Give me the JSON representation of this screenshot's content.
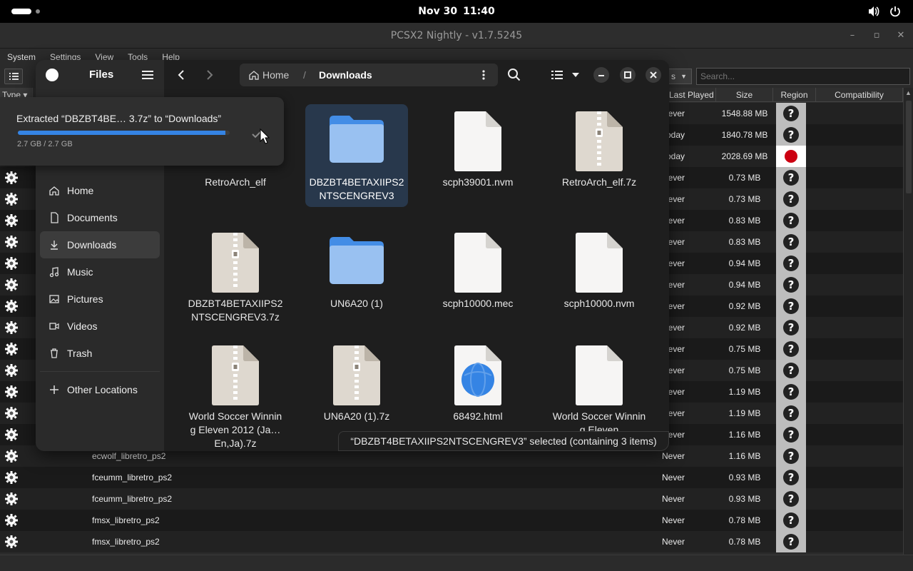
{
  "topbar": {
    "date": "Nov 30",
    "time": "11:40"
  },
  "pcsx2": {
    "title": "PCSX2 Nightly - v1.7.5245",
    "menu": [
      "System",
      "Settings",
      "View",
      "Tools",
      "Help"
    ],
    "view_combo": "s",
    "search_placeholder": "Search...",
    "columns": {
      "type": "Type",
      "last_played": "Last Played",
      "size": "Size",
      "region": "Region",
      "compatibility": "Compatibility"
    },
    "rows": [
      {
        "title": "",
        "last": "Never",
        "size": "1548.88 MB",
        "region": "unknown"
      },
      {
        "title": "",
        "last": "Today",
        "size": "1840.78 MB",
        "region": "unknown"
      },
      {
        "title": "",
        "last": "Today",
        "size": "2028.69 MB",
        "region": "japan"
      },
      {
        "title": "",
        "last": "Never",
        "size": "0.73 MB",
        "region": "unknown"
      },
      {
        "title": "",
        "last": "Never",
        "size": "0.73 MB",
        "region": "unknown"
      },
      {
        "title": "",
        "last": "Never",
        "size": "0.83 MB",
        "region": "unknown"
      },
      {
        "title": "",
        "last": "Never",
        "size": "0.83 MB",
        "region": "unknown"
      },
      {
        "title": "",
        "last": "Never",
        "size": "0.94 MB",
        "region": "unknown"
      },
      {
        "title": "",
        "last": "Never",
        "size": "0.94 MB",
        "region": "unknown"
      },
      {
        "title": "",
        "last": "Never",
        "size": "0.92 MB",
        "region": "unknown"
      },
      {
        "title": "",
        "last": "Never",
        "size": "0.92 MB",
        "region": "unknown"
      },
      {
        "title": "",
        "last": "Never",
        "size": "0.75 MB",
        "region": "unknown"
      },
      {
        "title": "",
        "last": "Never",
        "size": "0.75 MB",
        "region": "unknown"
      },
      {
        "title": "",
        "last": "Never",
        "size": "1.19 MB",
        "region": "unknown"
      },
      {
        "title": "",
        "last": "Never",
        "size": "1.19 MB",
        "region": "unknown"
      },
      {
        "title": "",
        "last": "Never",
        "size": "1.16 MB",
        "region": "unknown"
      },
      {
        "title": "ecwolf_libretro_ps2",
        "last": "Never",
        "size": "1.16 MB",
        "region": "unknown"
      },
      {
        "title": "fceumm_libretro_ps2",
        "last": "Never",
        "size": "0.93 MB",
        "region": "unknown"
      },
      {
        "title": "fceumm_libretro_ps2",
        "last": "Never",
        "size": "0.93 MB",
        "region": "unknown"
      },
      {
        "title": "fmsx_libretro_ps2",
        "last": "Never",
        "size": "0.78 MB",
        "region": "unknown"
      },
      {
        "title": "fmsx_libretro_ps2",
        "last": "Never",
        "size": "0.78 MB",
        "region": "unknown"
      }
    ]
  },
  "files": {
    "app_title": "Files",
    "path": {
      "home": "Home",
      "separator": "/",
      "current": "Downloads"
    },
    "places": [
      {
        "label": "Home",
        "icon": "home-icon"
      },
      {
        "label": "Documents",
        "icon": "document-icon"
      },
      {
        "label": "Downloads",
        "icon": "download-icon",
        "active": true
      },
      {
        "label": "Music",
        "icon": "music-icon"
      },
      {
        "label": "Pictures",
        "icon": "picture-icon"
      },
      {
        "label": "Videos",
        "icon": "video-icon"
      },
      {
        "label": "Trash",
        "icon": "trash-icon"
      }
    ],
    "other_locations": "Other Locations",
    "items": [
      {
        "name": "RetroArch_elf",
        "kind": "folder"
      },
      {
        "name": "DBZBT4BETAXIIPS2NTSCENGREV3",
        "kind": "folder",
        "selected": true
      },
      {
        "name": "scph39001.nvm",
        "kind": "file"
      },
      {
        "name": "RetroArch_elf.7z",
        "kind": "archive"
      },
      {
        "name": "DBZBT4BETAXIIPS2NTSCENGREV3.7z",
        "kind": "archive"
      },
      {
        "name": "UN6A20 (1)",
        "kind": "folder"
      },
      {
        "name": "scph10000.mec",
        "kind": "file"
      },
      {
        "name": "scph10000.nvm",
        "kind": "file"
      },
      {
        "name": "World Soccer Winning Eleven 2012 (Ja… En,Ja).7z",
        "kind": "archive"
      },
      {
        "name": "UN6A20 (1).7z",
        "kind": "archive"
      },
      {
        "name": "68492.html",
        "kind": "html"
      },
      {
        "name": "World Soccer Winning Eleven",
        "kind": "file"
      }
    ],
    "status": "“DBZBT4BETAXIIPS2NTSCENGREV3” selected  (containing 3 items)"
  },
  "toast": {
    "title": "Extracted “DBZBT4BE… 3.7z” to “Downloads”",
    "progress": "2.7 GB / 2.7 GB",
    "progress_fraction": 0.98
  },
  "colors": {
    "accent": "#3584e4",
    "folder": "#99c1f1",
    "selection": "#28384c",
    "flag_red": "#cc0011"
  }
}
